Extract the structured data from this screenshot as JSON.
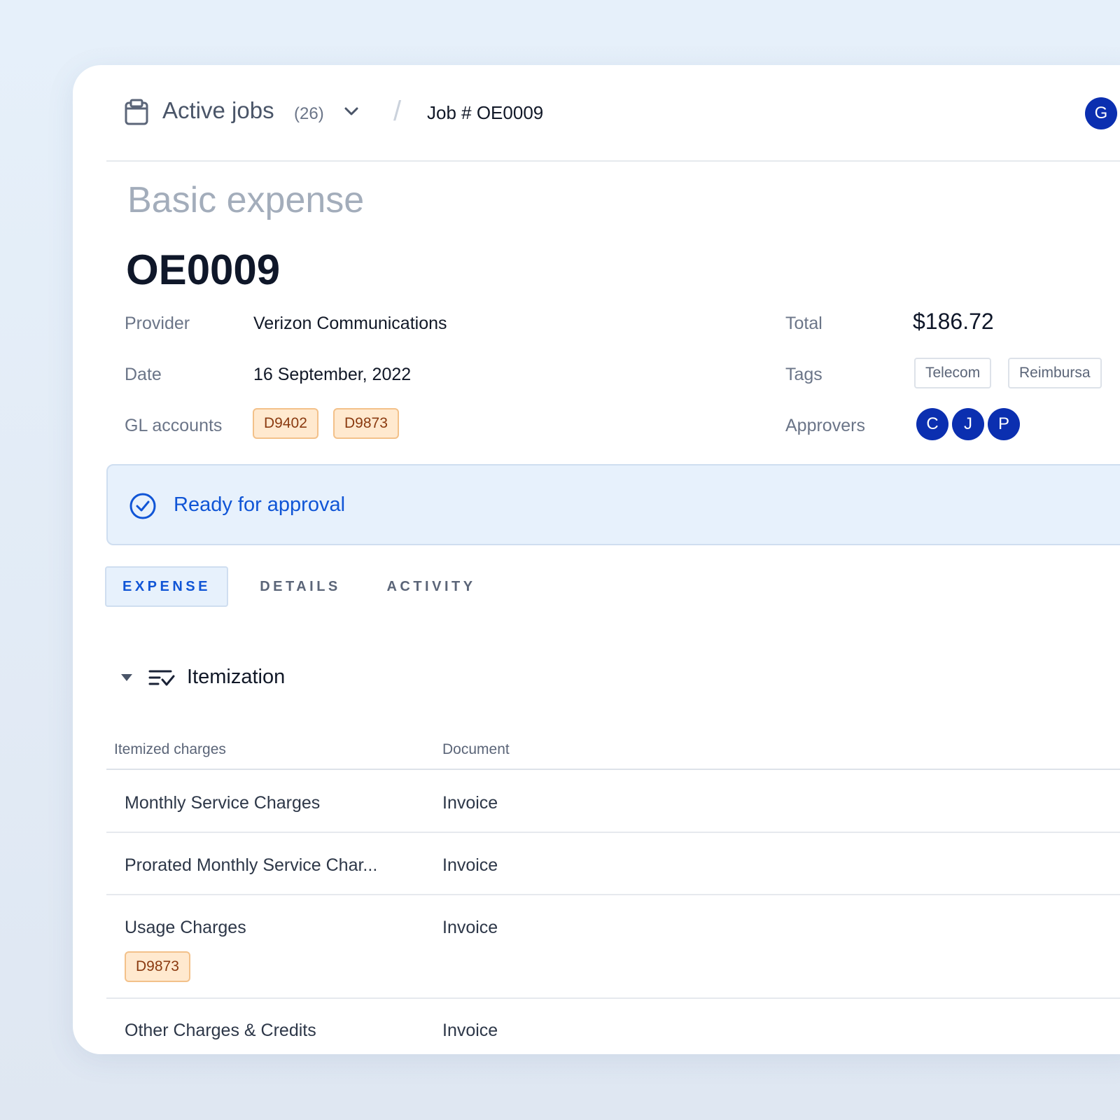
{
  "header": {
    "title": "Active jobs",
    "count": "(26)",
    "separator": "/",
    "job": "Job # OE0009",
    "user_initial": "G"
  },
  "expense": {
    "type": "Basic expense",
    "id": "OE0009"
  },
  "fields": {
    "provider_label": "Provider",
    "provider_value": "Verizon Communications",
    "date_label": "Date",
    "date_value": "16 September, 2022",
    "gl_label": "GL accounts",
    "gl_accounts": [
      "D9402",
      "D9873"
    ],
    "total_label": "Total",
    "total_value": "$186.72",
    "tags_label": "Tags",
    "tags": [
      "Telecom",
      "Reimbursa"
    ],
    "approvers_label": "Approvers",
    "approvers": [
      "C",
      "J",
      "P"
    ]
  },
  "status": {
    "text": "Ready for approval"
  },
  "tabs": [
    {
      "label": "EXPENSE",
      "active": true
    },
    {
      "label": "DETAILS",
      "active": false
    },
    {
      "label": "ACTIVITY",
      "active": false
    }
  ],
  "itemization": {
    "title": "Itemization",
    "columns": [
      "Itemized charges",
      "Document"
    ],
    "rows": [
      {
        "charge": "Monthly Service Charges",
        "document": "Invoice"
      },
      {
        "charge": "Prorated Monthly Service Char...",
        "document": "Invoice"
      },
      {
        "charge": "Usage Charges",
        "document": "Invoice",
        "gl": "D9873"
      },
      {
        "charge": "Other Charges & Credits",
        "document": "Invoice"
      }
    ]
  },
  "colors": {
    "accent": "#1055d6",
    "avatar": "#0b2fb0",
    "gl_chip_bg": "#ffe9cf",
    "gl_chip_border": "#f3c18a",
    "status_bg": "#e7f1fc"
  }
}
